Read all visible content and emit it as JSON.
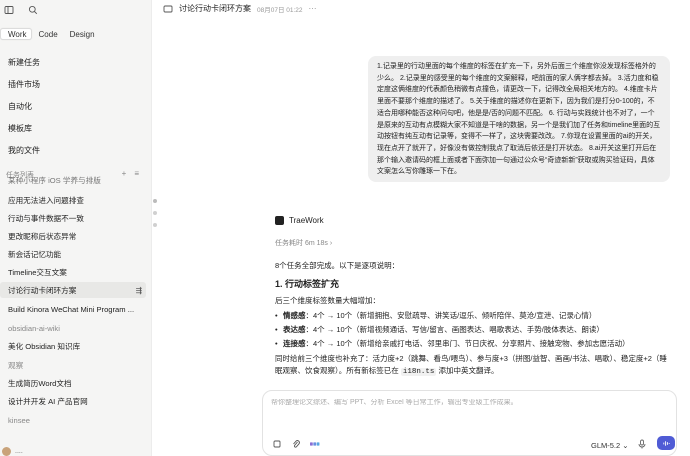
{
  "header": {
    "title": "讨论行动卡闭环方案",
    "timestamp": "08月07日 01:22",
    "more": "···"
  },
  "sidebar": {
    "modes": [
      "Work",
      "Code",
      "Design"
    ],
    "nav": [
      {
        "label": "新建任务",
        "icon": "new-task-icon"
      },
      {
        "label": "插件市场",
        "icon": "plugin-icon"
      },
      {
        "label": "自动化",
        "icon": "automation-icon"
      },
      {
        "label": "模板库",
        "icon": "template-icon"
      },
      {
        "label": "我的文件",
        "icon": "folder-icon"
      }
    ],
    "section_label": "任务列表",
    "partial_item": "某种小程序 iOS 学养与排版",
    "tasks": [
      {
        "label": "应用无法进入问题排查"
      },
      {
        "label": "行动与事件数据不一致"
      },
      {
        "label": "更改昵称后状态异常"
      },
      {
        "label": "新会话记忆功能"
      },
      {
        "label": "Timeline交互文案"
      },
      {
        "label": "讨论行动卡闭环方案",
        "active": true
      },
      {
        "label": "Build Kinora WeChat Mini Program ..."
      }
    ],
    "group1": "obsidian-ai-wiki",
    "group1_items": [
      "美化 Obsidian 知识库"
    ],
    "group2": "观察",
    "group2_items": [
      "生成简历Word文档",
      "设计并开发 AI 产品官网"
    ],
    "group3": "kinsee",
    "user": "...."
  },
  "chat": {
    "user_message": "1.记录里的行动里面的每个维度的标签在扩充一下，另外后面三个维度你没发现标签格外的少么。 2.记录里的感受里的每个维度的文案解释，吧前面的家人俩字都去掉。 3.活力度和稳定度这俩维度的代表颜色稍微有点撞色，请更改一下，记得改全局相关地方的。 4.维度卡片里面不要那个维度的描述了。 5.关于维度的描述你在更新下，因为我们是打分0-100的，不适合用哪种能否这种问句吧，他是是/否的问题不匹配。 6. 行动与实践统计也不对了，一个是原来的互动有点模糊大家不知道是干啥的数据，另一个是我们加了任务和timeline里面的互动按钮有纯互动有记录等，变得不一样了，这块需要改改。 7.你现在设置里面的ai的开关，现在点开了就开了，好像没有做控制我点了取消后依还是打开状态。 8.ai开关这里打开后在那个输入邀请码的框上面或者下面弥加一句通过公众号“奇迹新新”获取或购买验证码，具体文案怎么写你雕琢一下在。",
    "ai_name": "TraeWork",
    "ai_meta": "任务耗时 6m 18s",
    "ai_intro": "8个任务全部完成。以下是逐项说明：",
    "ai_heading": "1. 行动标签扩充",
    "ai_sub": "后三个维度标签数量大幅增加：",
    "ai_bullets": [
      {
        "key": "情感感",
        "text": "：4个 → 10个（新增拥抱、安慰疏导、讲笑话/逗乐、倾听陪伴、莫沧/宣泄、记录心情）"
      },
      {
        "key": "表达感",
        "text": "：4个 → 10个（新增视频通话、写信/留言、画图表达、唱歌表达、手势/肢体表达、朗读）"
      },
      {
        "key": "连接感",
        "text": "：4个 → 10个（新增给亲戚打电话、邻里串门、节日庆祝、分享照片、接触宠物、参加志愿活动）"
      }
    ],
    "ai_tail_pre": "同时给前三个维度也补充了：活力度+2（跳舞、看鸟/喂鸟）、参与度+3（拼图/益智、画画/书法、唱歌）、稳定度+2（睡眠观察、饮食观察）。所有新标签已在 ",
    "ai_tail_code": "i18n.ts",
    "ai_tail_post": " 添加中英文翻译。"
  },
  "composer": {
    "placeholder": "帮你整理论文综述、编写 PPT、分析 Excel 等日常工作，输出专业级工作成果。",
    "model": "GLM-5.2 ⌄"
  }
}
